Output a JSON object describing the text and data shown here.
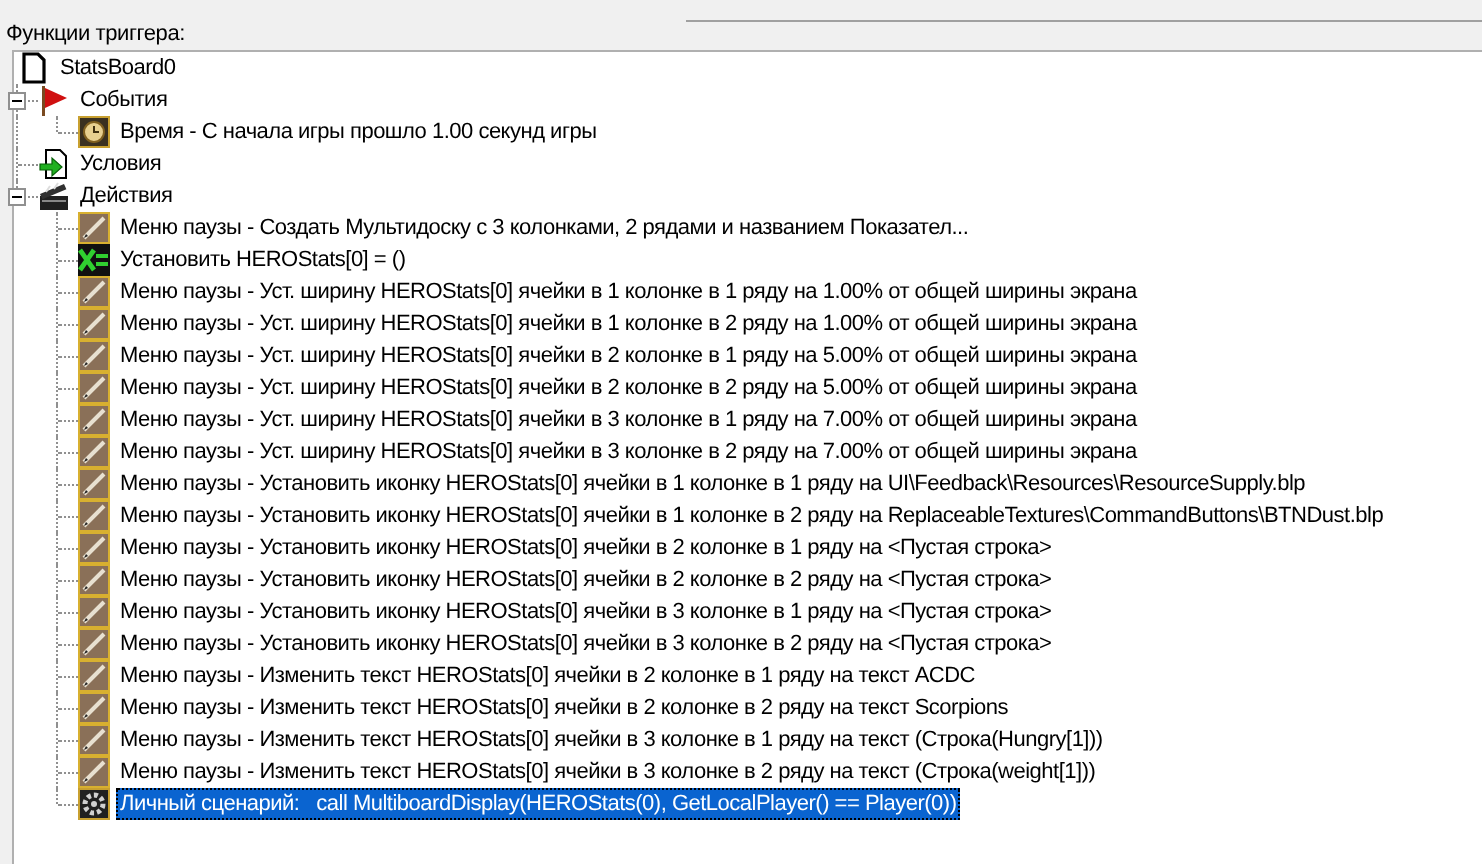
{
  "group_label": "Функции триггера:",
  "tree": [
    {
      "kind": "root",
      "label": "StatsBoard0",
      "selected": false,
      "children": [
        {
          "kind": "events",
          "label": "События",
          "expanded": true,
          "selected": false,
          "children": [
            {
              "kind": "timer",
              "label": "Время - С начала игры прошло 1.00 секунд игры",
              "selected": false
            }
          ]
        },
        {
          "kind": "conditions",
          "label": "Условия",
          "selected": false
        },
        {
          "kind": "actions",
          "label": "Действия",
          "expanded": true,
          "selected": false,
          "children": [
            {
              "kind": "board",
              "label": "Меню паузы - Создать Мультидоску с 3 колонками, 2 рядами и названием Показател...",
              "selected": false
            },
            {
              "kind": "variable",
              "label": "Установить HEROStats[0] = ()",
              "selected": false
            },
            {
              "kind": "board",
              "label": "Меню паузы - Уст. ширину HEROStats[0] ячейки в 1 колонке в 1 ряду на 1.00% от общей ширины экрана",
              "selected": false
            },
            {
              "kind": "board",
              "label": "Меню паузы - Уст. ширину HEROStats[0] ячейки в 1 колонке в 2 ряду на 1.00% от общей ширины экрана",
              "selected": false
            },
            {
              "kind": "board",
              "label": "Меню паузы - Уст. ширину HEROStats[0] ячейки в 2 колонке в 1 ряду на 5.00% от общей ширины экрана",
              "selected": false
            },
            {
              "kind": "board",
              "label": "Меню паузы - Уст. ширину HEROStats[0] ячейки в 2 колонке в 2 ряду на 5.00% от общей ширины экрана",
              "selected": false
            },
            {
              "kind": "board",
              "label": "Меню паузы - Уст. ширину HEROStats[0] ячейки в 3 колонке в 1 ряду на 7.00% от общей ширины экрана",
              "selected": false
            },
            {
              "kind": "board",
              "label": "Меню паузы - Уст. ширину HEROStats[0] ячейки в 3 колонке в 2 ряду на 7.00% от общей ширины экрана",
              "selected": false
            },
            {
              "kind": "board",
              "label": "Меню паузы - Установить иконку HEROStats[0] ячейки в 1 колонке в 1 ряду на UI\\Feedback\\Resources\\ResourceSupply.blp",
              "selected": false
            },
            {
              "kind": "board",
              "label": "Меню паузы - Установить иконку HEROStats[0] ячейки в 1 колонке в 2 ряду на ReplaceableTextures\\CommandButtons\\BTNDust.blp",
              "selected": false
            },
            {
              "kind": "board",
              "label": "Меню паузы - Установить иконку HEROStats[0] ячейки в 2 колонке в 1 ряду на <Пустая строка>",
              "selected": false
            },
            {
              "kind": "board",
              "label": "Меню паузы - Установить иконку HEROStats[0] ячейки в 2 колонке в 2 ряду на <Пустая строка>",
              "selected": false
            },
            {
              "kind": "board",
              "label": "Меню паузы - Установить иконку HEROStats[0] ячейки в 3 колонке в 1 ряду на <Пустая строка>",
              "selected": false
            },
            {
              "kind": "board",
              "label": "Меню паузы - Установить иконку HEROStats[0] ячейки в 3 колонке в 2 ряду на <Пустая строка>",
              "selected": false
            },
            {
              "kind": "board",
              "label": "Меню паузы - Изменить текст HEROStats[0] ячейки в 2 колонке в 1 ряду на текст ACDC",
              "selected": false
            },
            {
              "kind": "board",
              "label": "Меню паузы - Изменить текст HEROStats[0] ячейки в 2 колонке в 2 ряду на текст Scorpions",
              "selected": false
            },
            {
              "kind": "board",
              "label": "Меню паузы - Изменить текст HEROStats[0] ячейки в 3 колонке в 1 ряду на текст (Строка(Hungry[1]))",
              "selected": false
            },
            {
              "kind": "board",
              "label": "Меню паузы - Изменить текст HEROStats[0] ячейки в 3 колонке в 2 ряду на текст (Строка(weight[1]))",
              "selected": false
            },
            {
              "kind": "script",
              "label": "Личный сценарий:   call MultiboardDisplay(HEROStats(0), GetLocalPlayer() == Player(0))",
              "selected": true
            }
          ]
        }
      ]
    }
  ]
}
